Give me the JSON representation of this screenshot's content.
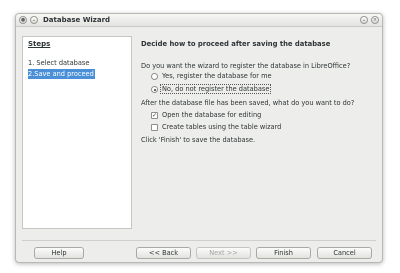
{
  "window": {
    "title": "Database Wizard",
    "icons": [
      "app-icon",
      "menu-icon",
      "minimize-icon",
      "close-icon"
    ]
  },
  "sidebar": {
    "heading": "Steps",
    "items": [
      {
        "label": "1. Select database",
        "selected": false
      },
      {
        "label": "2.Save and proceed",
        "selected": true
      }
    ]
  },
  "main": {
    "heading": "Decide how to proceed after saving the database",
    "register_question": "Do you want the wizard to register the database in LibreOffice?",
    "register_yes": "Yes, register the database for me",
    "register_no": "No, do not register the database",
    "register_selected": "no",
    "after_save_question": "After the database file has been saved, what do you want to do?",
    "open_for_editing": "Open the database for editing",
    "open_for_editing_checked": true,
    "create_tables": "Create tables using the table wizard",
    "create_tables_checked": false,
    "finish_hint": "Click 'Finish' to save the database."
  },
  "buttons": {
    "help": "Help",
    "back": "<< Back",
    "next": "Next >>",
    "finish": "Finish",
    "cancel": "Cancel"
  },
  "colors": {
    "selection": "#4a90d9",
    "window_bg": "#ededeb"
  }
}
